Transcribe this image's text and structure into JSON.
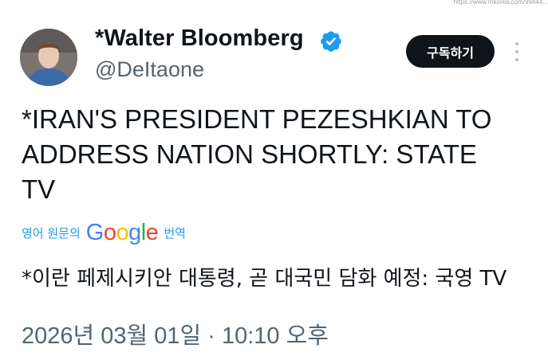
{
  "url_fragment": "https://www.mkorea.com/99444...",
  "author": {
    "display_name": "*Walter Bloomberg",
    "handle": "@DeItaone",
    "verified": true,
    "verified_color": "#1d9bf0"
  },
  "actions": {
    "subscribe_label": "구독하기"
  },
  "tweet": {
    "lines": [
      "*IRAN'S PRESIDENT PEZESHKIAN TO",
      "ADDRESS NATION SHORTLY: STATE",
      "TV"
    ]
  },
  "translation": {
    "prefix": "영어 원문의",
    "brand": "Google",
    "suffix": "번역",
    "text": "*이란 페제시키안 대통령, 곧 대국민 담화 예정: 국영 TV"
  },
  "timestamp": "2026년 03월 01일 · 10:10 오후",
  "colors": {
    "google_blue": "#4285F4",
    "google_red": "#EA4335",
    "google_yellow": "#FBBC05",
    "google_green": "#34A853"
  }
}
